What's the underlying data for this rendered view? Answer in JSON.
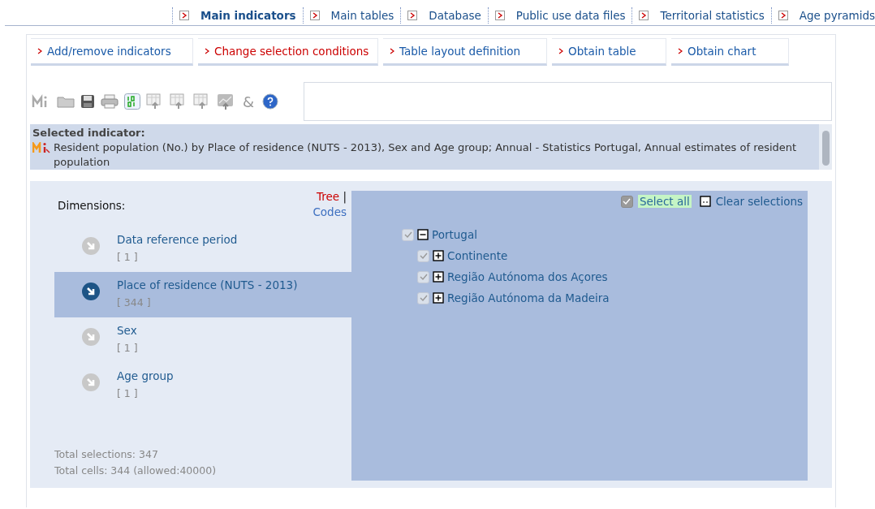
{
  "top_nav": [
    {
      "label": "Main indicators",
      "selected": true
    },
    {
      "label": "Main tables",
      "selected": false
    },
    {
      "label": "Database",
      "selected": false
    },
    {
      "label": "Public use data files",
      "selected": false
    },
    {
      "label": "Territorial statistics",
      "selected": false
    },
    {
      "label": "Age pyramids",
      "selected": false
    }
  ],
  "steps": [
    {
      "label": "Add/remove indicators",
      "selected": false
    },
    {
      "label": "Change selection conditions",
      "selected": true
    },
    {
      "label": "Table layout definition",
      "selected": false
    },
    {
      "label": "Obtain table",
      "selected": false
    },
    {
      "label": "Obtain chart",
      "selected": false
    }
  ],
  "toolbar": {
    "items": [
      {
        "kind": "mi"
      },
      {
        "kind": "folder"
      },
      {
        "kind": "save"
      },
      {
        "kind": "print"
      },
      {
        "kind": "binary"
      },
      {
        "kind": "export"
      },
      {
        "kind": "export"
      },
      {
        "kind": "export"
      },
      {
        "kind": "chart"
      },
      {
        "kind": "amp",
        "text": "&"
      },
      {
        "kind": "help"
      }
    ]
  },
  "selected_indicator": {
    "heading": "Selected indicator:",
    "text": "Resident population (No.) by Place of residence (NUTS - 2013), Sex and Age group; Annual - Statistics Portugal, Annual estimates of resident population"
  },
  "dimensions": {
    "heading": "Dimensions:",
    "view_tree": "Tree",
    "separator": "|",
    "view_codes": "Codes",
    "items": [
      {
        "name": "Data reference period",
        "count": "[ 1 ]",
        "selected": false
      },
      {
        "name": "Place of residence (NUTS - 2013)",
        "count": "[ 344 ]",
        "selected": true
      },
      {
        "name": "Sex",
        "count": "[ 1 ]",
        "selected": false
      },
      {
        "name": "Age group",
        "count": "[ 1 ]",
        "selected": false
      }
    ],
    "total_selections": "Total selections: 347",
    "total_cells": "Total cells: 344 (allowed:40000)"
  },
  "selection": {
    "select_all": {
      "label": "Select all",
      "checked": true
    },
    "clear": "Clear selections",
    "tree": [
      {
        "label": "Portugal",
        "checked": true,
        "expanded": true,
        "children": [
          {
            "label": "Continente",
            "checked": true,
            "expanded": false
          },
          {
            "label": "Região Autónoma dos Açores",
            "checked": true,
            "expanded": false
          },
          {
            "label": "Região Autónoma da Madeira",
            "checked": true,
            "expanded": false
          }
        ]
      }
    ]
  }
}
